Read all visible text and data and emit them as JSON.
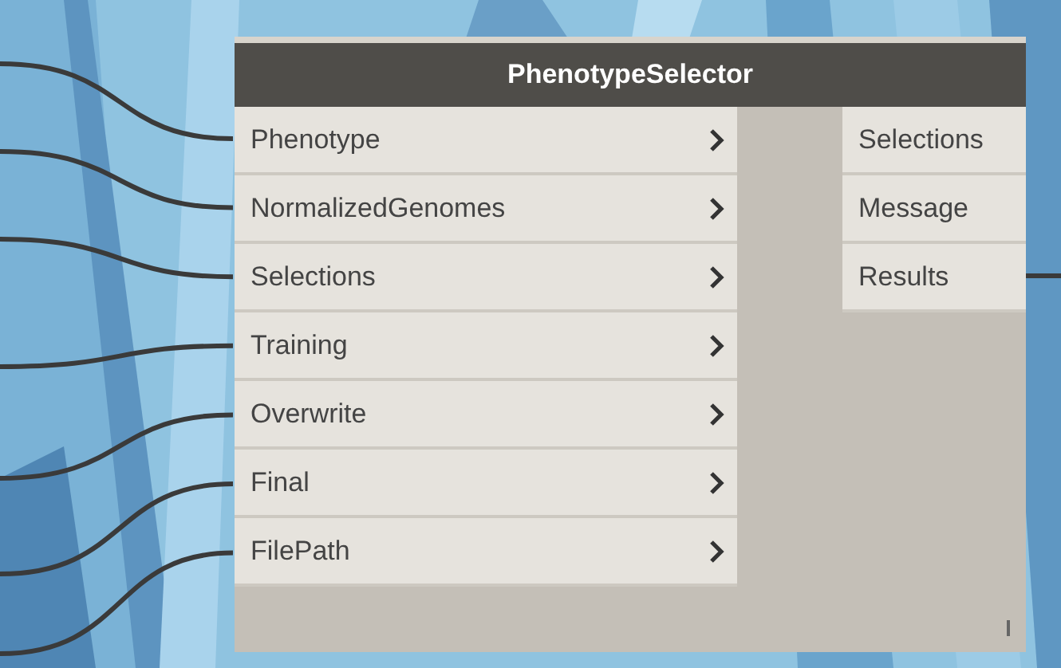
{
  "node": {
    "title": "PhenotypeSelector",
    "inputs": [
      {
        "label": "Phenotype"
      },
      {
        "label": "NormalizedGenomes"
      },
      {
        "label": "Selections"
      },
      {
        "label": "Training"
      },
      {
        "label": "Overwrite"
      },
      {
        "label": "Final"
      },
      {
        "label": "FilePath"
      }
    ],
    "outputs": [
      {
        "label": "Selections"
      },
      {
        "label": "Message"
      },
      {
        "label": "Results"
      }
    ]
  }
}
